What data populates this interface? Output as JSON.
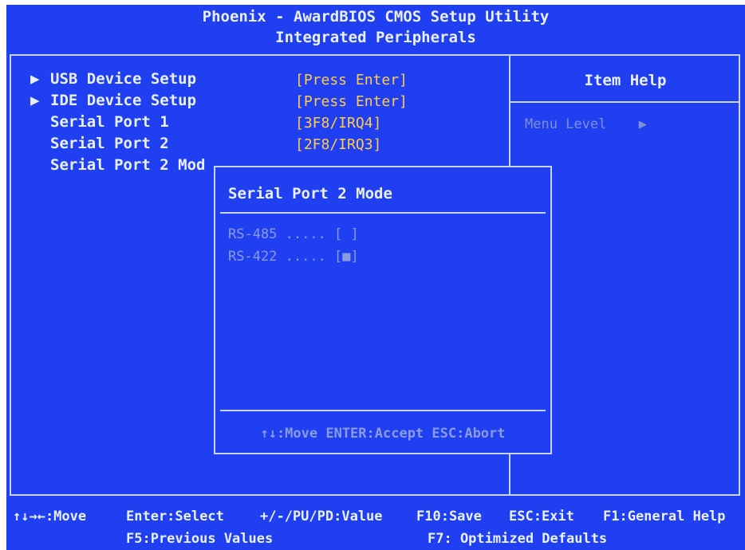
{
  "header": {
    "title_line1": "Phoenix - AwardBIOS CMOS Setup Utility",
    "title_line2": "Integrated Peripherals"
  },
  "menu": {
    "items": [
      {
        "label": "USB Device Setup",
        "value": "[Press Enter]",
        "has_submenu": true
      },
      {
        "label": "IDE Device Setup",
        "value": "[Press Enter]",
        "has_submenu": true
      },
      {
        "label": "Serial Port 1",
        "value": "[3F8/IRQ4]",
        "has_submenu": false
      },
      {
        "label": "Serial Port 2",
        "value": "[2F8/IRQ3]",
        "has_submenu": false
      },
      {
        "label": "Serial Port 2 Mod",
        "value": "",
        "has_submenu": false
      }
    ],
    "submenu_marker": "▶"
  },
  "help": {
    "title": "Item Help",
    "menu_level_label": "Menu Level",
    "menu_level_marker": "▶"
  },
  "popup": {
    "title": "Serial Port 2 Mode",
    "options": [
      {
        "text": "RS-485 ..... [ ]",
        "selected": false
      },
      {
        "text": "RS-422 ..... [■]",
        "selected": true
      }
    ],
    "footer": "↑↓:Move ENTER:Accept ESC:Abort"
  },
  "footer": {
    "move": "↑↓→←:Move",
    "select": "Enter:Select",
    "value": "+/-/PU/PD:Value",
    "save": "F10:Save",
    "exit": "ESC:Exit",
    "help": "F1:General Help",
    "previous": "F5:Previous Values",
    "defaults": "F7: Optimized Defaults"
  },
  "colors": {
    "background": "#1f3ff0",
    "text": "#e8f0ff",
    "value_text": "#ffcc4a",
    "dim_text": "#8a9be0"
  }
}
